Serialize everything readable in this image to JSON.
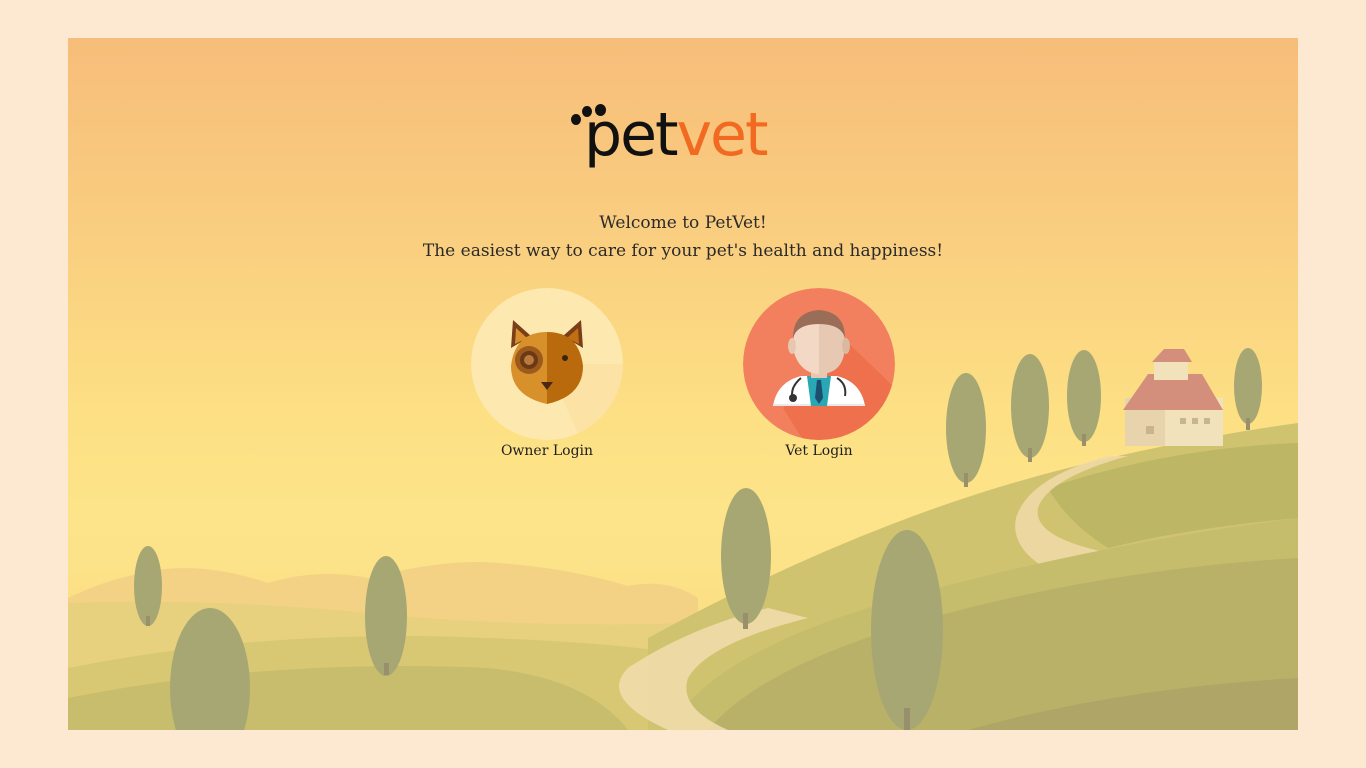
{
  "app": {
    "logo_pet": "pet",
    "logo_vet": "vet",
    "brand_colors": {
      "dark": "#111111",
      "accent": "#f26a21",
      "page_background": "#fde8d2"
    }
  },
  "welcome": {
    "line1": "Welcome to PetVet!",
    "line2": "The easiest way to care for your pet's health and happiness!"
  },
  "logins": {
    "owner": {
      "label": "Owner Login",
      "icon": "dog-icon",
      "circle_color": "#fde9b0"
    },
    "vet": {
      "label": "Vet Login",
      "icon": "veterinarian-icon",
      "circle_color": "#f2805e"
    }
  }
}
